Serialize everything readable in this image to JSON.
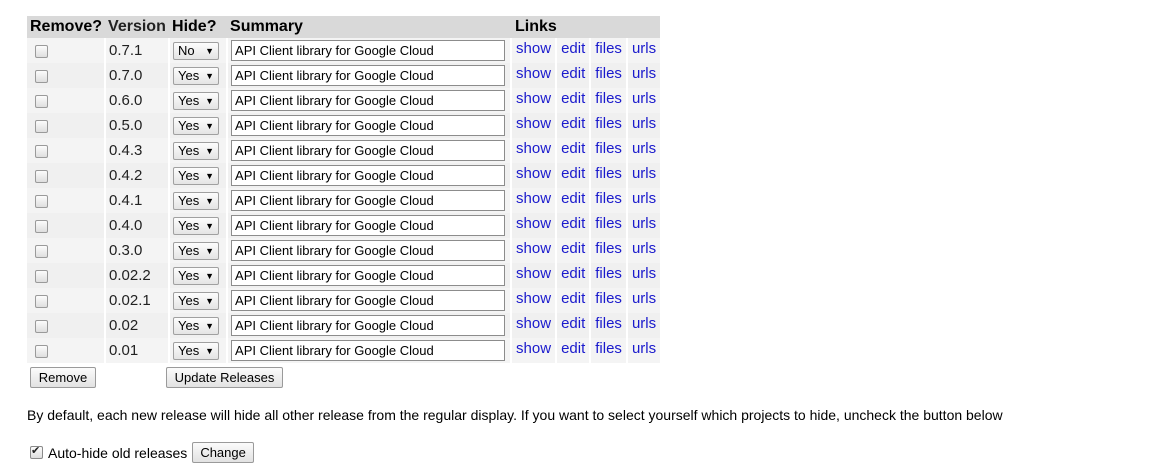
{
  "table": {
    "headers": {
      "remove": "Remove?",
      "version": "Version",
      "hide": "Hide?",
      "summary": "Summary",
      "links": "Links"
    },
    "rows": [
      {
        "version": "0.7.1",
        "hide": "No",
        "summary": "API Client library for Google Cloud"
      },
      {
        "version": "0.7.0",
        "hide": "Yes",
        "summary": "API Client library for Google Cloud"
      },
      {
        "version": "0.6.0",
        "hide": "Yes",
        "summary": "API Client library for Google Cloud"
      },
      {
        "version": "0.5.0",
        "hide": "Yes",
        "summary": "API Client library for Google Cloud"
      },
      {
        "version": "0.4.3",
        "hide": "Yes",
        "summary": "API Client library for Google Cloud"
      },
      {
        "version": "0.4.2",
        "hide": "Yes",
        "summary": "API Client library for Google Cloud"
      },
      {
        "version": "0.4.1",
        "hide": "Yes",
        "summary": "API Client library for Google Cloud"
      },
      {
        "version": "0.4.0",
        "hide": "Yes",
        "summary": "API Client library for Google Cloud"
      },
      {
        "version": "0.3.0",
        "hide": "Yes",
        "summary": "API Client library for Google Cloud"
      },
      {
        "version": "0.02.2",
        "hide": "Yes",
        "summary": "API Client library for Google Cloud"
      },
      {
        "version": "0.02.1",
        "hide": "Yes",
        "summary": "API Client library for Google Cloud"
      },
      {
        "version": "0.02",
        "hide": "Yes",
        "summary": "API Client library for Google Cloud"
      },
      {
        "version": "0.01",
        "hide": "Yes",
        "summary": "API Client library for Google Cloud"
      }
    ],
    "link_labels": {
      "show": "show",
      "edit": "edit",
      "files": "files",
      "urls": "urls"
    }
  },
  "buttons": {
    "remove": "Remove",
    "update": "Update Releases",
    "change": "Change"
  },
  "info_text": "By default, each new release will hide all other release from the regular display. If you want to select yourself which projects to hide, uncheck the button below",
  "autohide": {
    "label": "Auto-hide old releases",
    "checked": true
  },
  "colors": {
    "link": "#1a1acd",
    "header_bg": "#d9d9d9",
    "row_bg": "#f0f0f0"
  }
}
